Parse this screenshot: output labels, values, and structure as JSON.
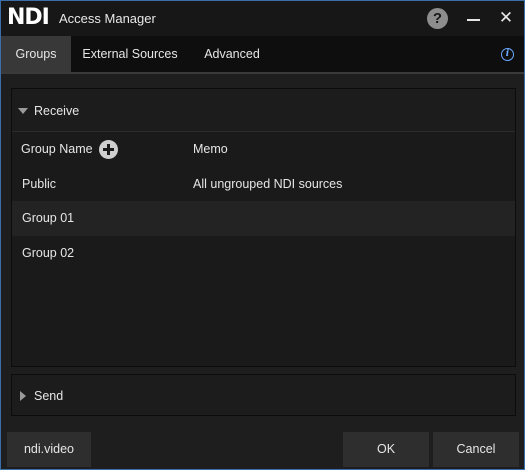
{
  "app": {
    "logo": "NDI",
    "title": "Access Manager"
  },
  "window_controls": {
    "help": "?",
    "close": "✕"
  },
  "tabs": [
    {
      "label": "Groups",
      "active": true
    },
    {
      "label": "External Sources",
      "active": false
    },
    {
      "label": "Advanced",
      "active": false
    }
  ],
  "info": "i",
  "receive": {
    "label": "Receive",
    "expanded": true,
    "columns": {
      "group_name": "Group Name",
      "memo": "Memo"
    },
    "rows": [
      {
        "group_name": "Public",
        "memo": "All ungrouped NDI sources"
      },
      {
        "group_name": "Group 01",
        "memo": ""
      },
      {
        "group_name": "Group 02",
        "memo": ""
      }
    ]
  },
  "send": {
    "label": "Send",
    "expanded": false
  },
  "footer": {
    "link_button": "ndi.video",
    "ok_button": "OK",
    "cancel_button": "Cancel"
  },
  "colors": {
    "window_border": "#3a6ea8",
    "info_accent": "#6aa8ff",
    "background": "#1e1e1e"
  }
}
